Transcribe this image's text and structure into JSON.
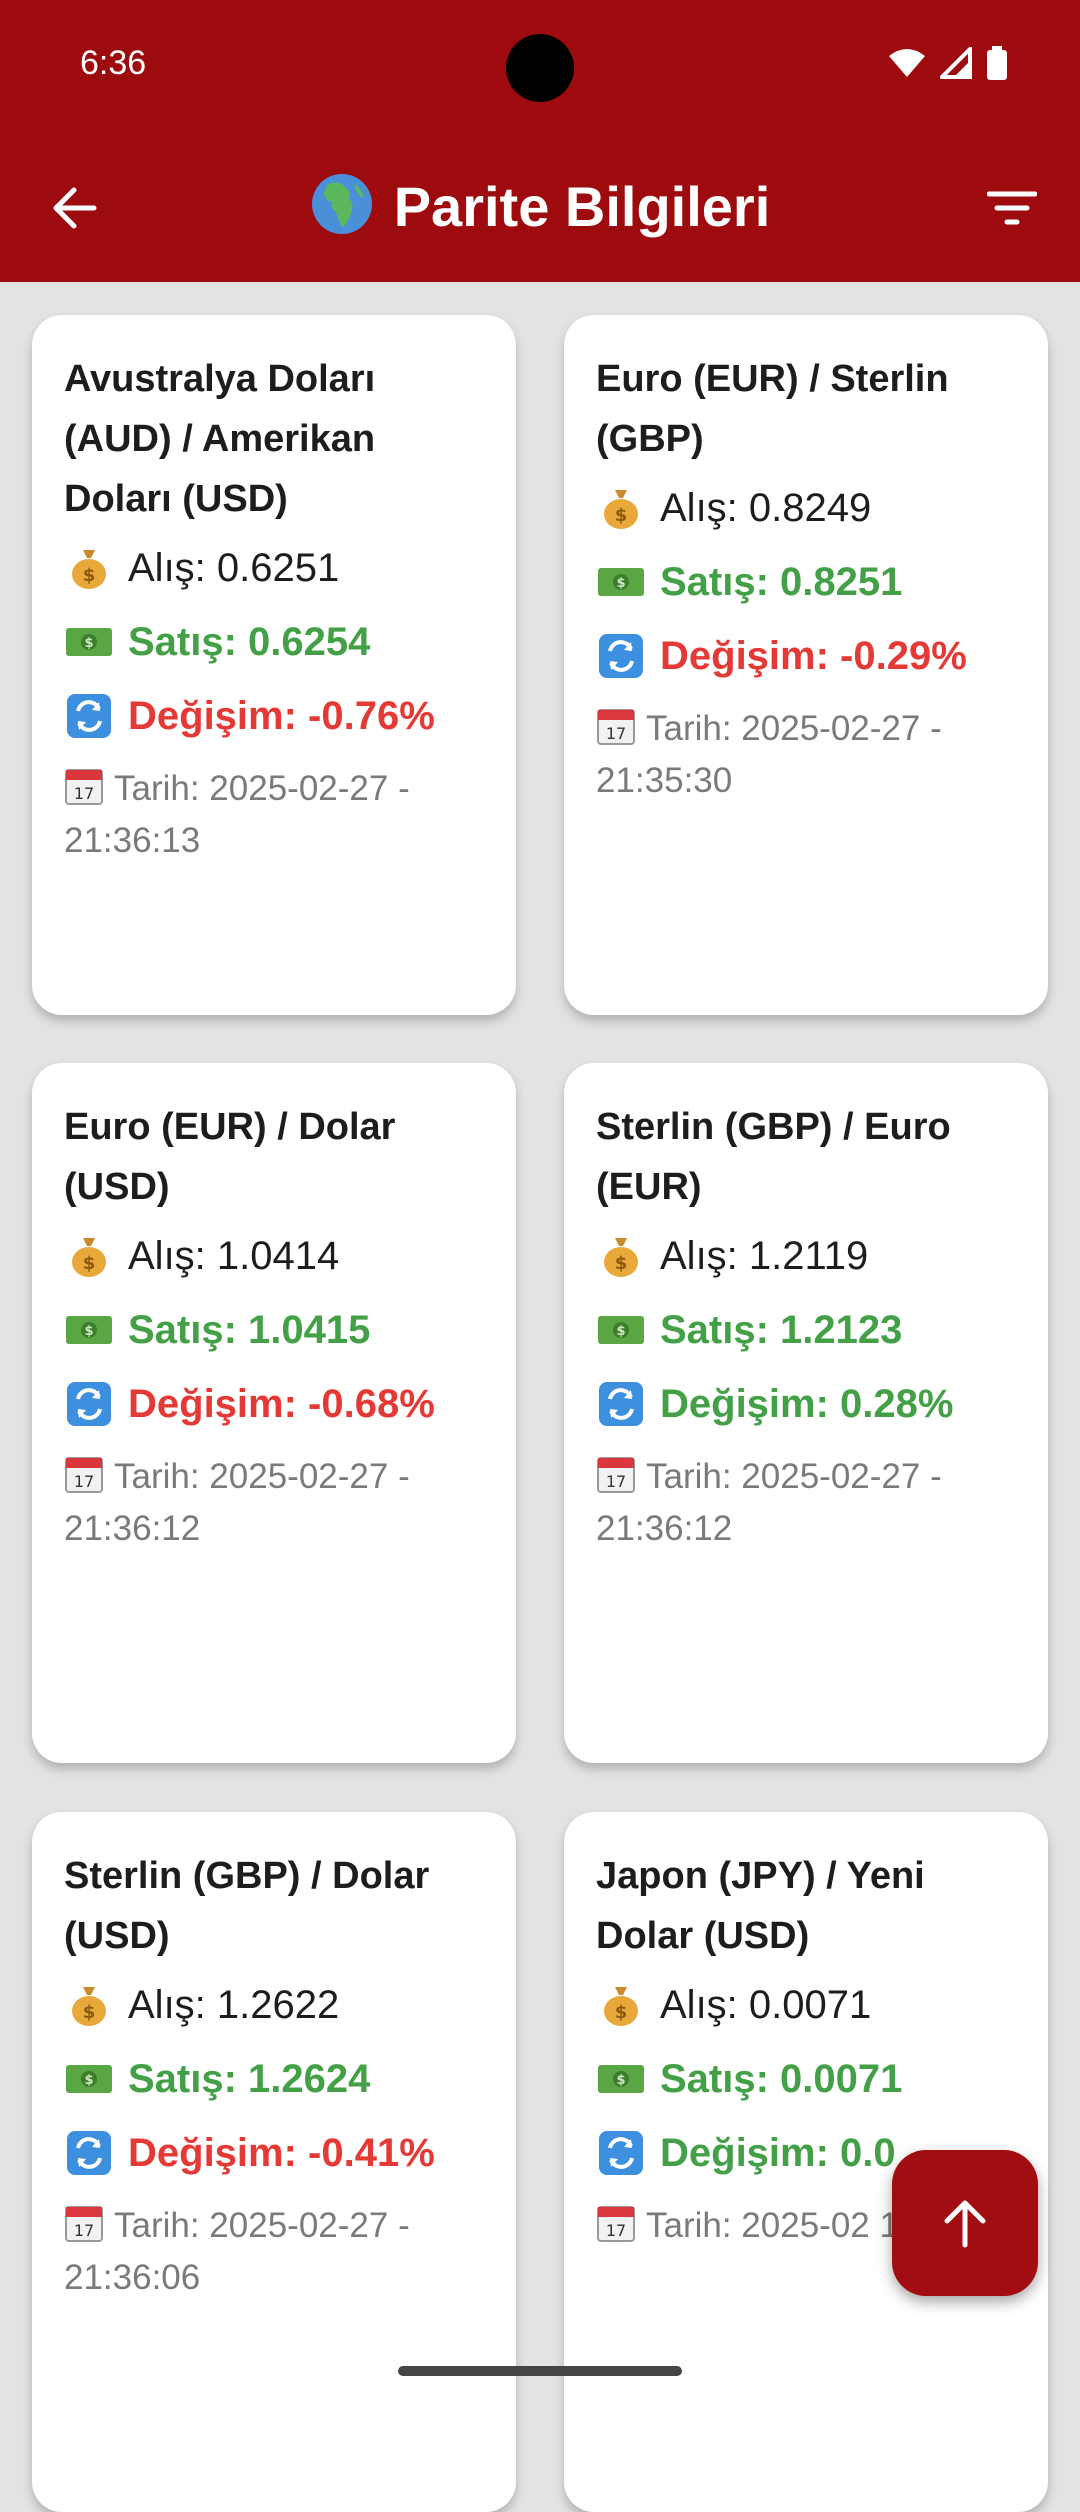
{
  "status": {
    "time": "6:36"
  },
  "header": {
    "title": "Parite Bilgileri"
  },
  "icons": {
    "back": "back-arrow-icon",
    "globe": "globe-africa-icon",
    "filter": "filter-icon",
    "alis": "money-bag-icon",
    "satis": "dollar-banknote-icon",
    "degisim": "arrows-counterclockwise-icon",
    "tarih": "calendar-icon",
    "fab": "arrow-up-icon"
  },
  "colors": {
    "primary": "#9e0b0e",
    "positive": "#43a047",
    "negative": "#e53935"
  },
  "cards": [
    {
      "title": "Avustralya Doları (AUD) / Amerikan Doları (USD)",
      "alis": "Alış: 0.6251",
      "satis": "Satış: 0.6254",
      "degisim": "Değişim: -0.76%",
      "tarih": "Tarih: 2025-02-27 - 21:36:13"
    },
    {
      "title": "Euro (EUR) / Sterlin (GBP)",
      "alis": "Alış: 0.8249",
      "satis": "Satış: 0.8251",
      "degisim": "Değişim: -0.29%",
      "tarih": "Tarih: 2025-02-27 - 21:35:30"
    },
    {
      "title": "Euro (EUR) / Dolar (USD)",
      "alis": "Alış: 1.0414",
      "satis": "Satış: 1.0415",
      "degisim": "Değişim: -0.68%",
      "tarih": "Tarih: 2025-02-27 - 21:36:12"
    },
    {
      "title": "Sterlin (GBP) / Euro (EUR)",
      "alis": "Alış: 1.2119",
      "satis": "Satış: 1.2123",
      "degisim": "Değişim: 0.28%",
      "tarih": "Tarih: 2025-02-27 - 21:36:12"
    },
    {
      "title": "Sterlin (GBP) / Dolar (USD)",
      "alis": "Alış: 1.2622",
      "satis": "Satış: 1.2624",
      "degisim": "Değişim: -0.41%",
      "tarih": "Tarih: 2025-02-27 - 21:36:06"
    },
    {
      "title": "Japon (JPY) / Yeni Dolar (USD)",
      "alis": "Alış: 0.0071",
      "satis": "Satış: 0.0071",
      "degisim": "Değişim: 0.0",
      "tarih": "Tarih: 2025-02 10/08/24"
    }
  ]
}
